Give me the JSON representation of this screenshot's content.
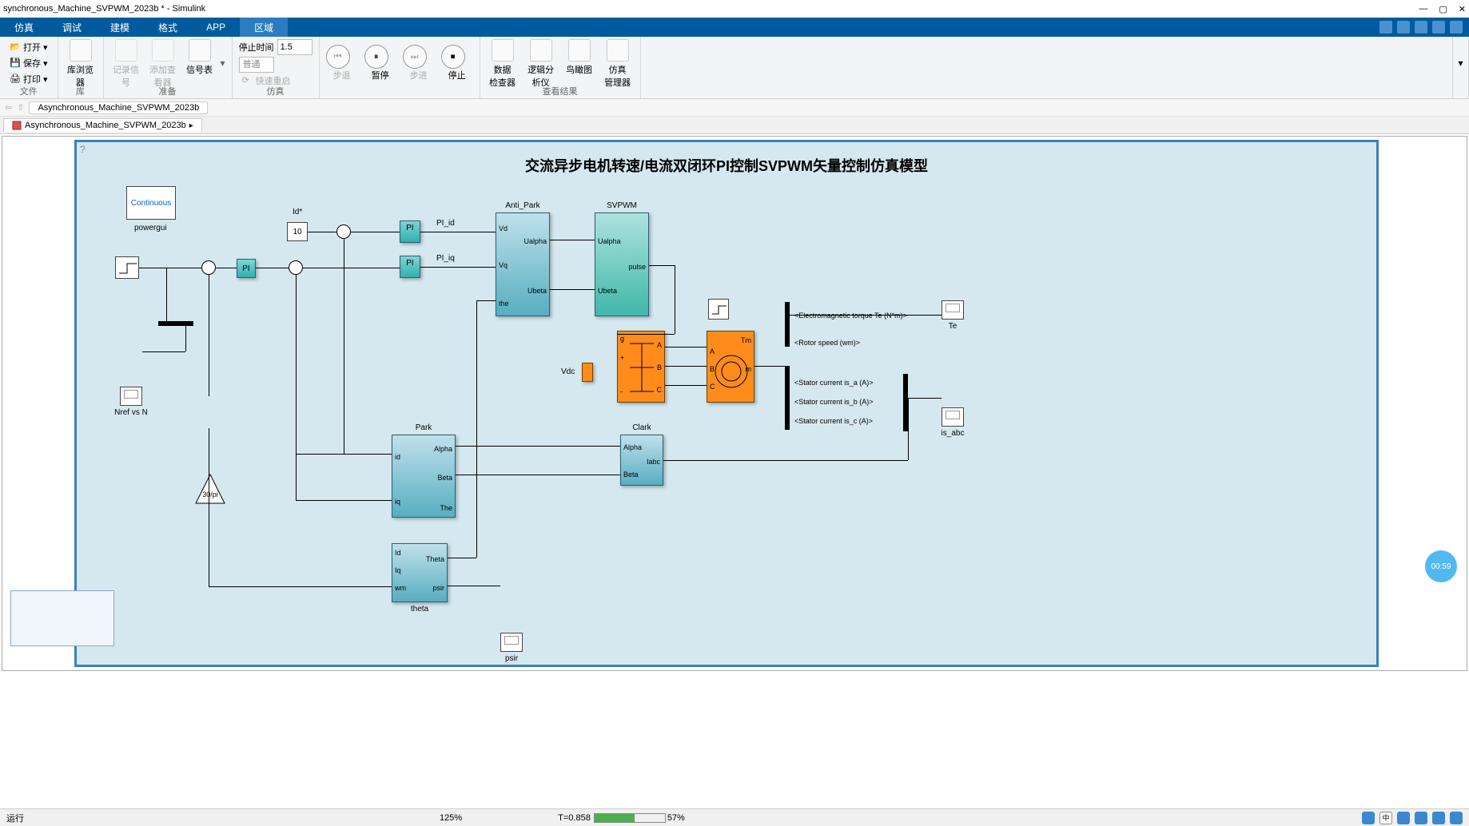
{
  "window": {
    "title": "synchronous_Machine_SVPWM_2023b * - Simulink"
  },
  "tabs": {
    "t1": "仿真",
    "t2": "调试",
    "t3": "建模",
    "t4": "格式",
    "t5": "APP",
    "t6": "区域"
  },
  "ribbon": {
    "file": {
      "open": "打开",
      "save": "保存",
      "print": "打印",
      "label": "文件"
    },
    "lib": {
      "browser": "库浏览器",
      "label": "库"
    },
    "prep": {
      "rec": "记录信号",
      "addv": "添加查看器",
      "sigtbl": "信号表",
      "label": "准备"
    },
    "sim": {
      "stoptime_lbl": "停止时间",
      "stoptime": "1.5",
      "mode": "普通",
      "fastrestart": "快速重启",
      "stepback": "步退",
      "pause": "暂停",
      "stepfwd": "步进",
      "stop": "停止",
      "label": "仿真"
    },
    "review": {
      "datainsp": "数据\n检查器",
      "logic": "逻辑分析仪",
      "bird": "鸟瞰图",
      "simmgr": "仿真\n管理器",
      "label": "查看结果"
    }
  },
  "nav": {
    "path": "Asynchronous_Machine_SVPWM_2023b"
  },
  "doctab": {
    "name": "Asynchronous_Machine_SVPWM_2023b"
  },
  "model": {
    "title": "交流异步电机转速/电流双闭环PI控制SVPWM矢量控制仿真模型",
    "powergui": "Continuous",
    "powergui_lbl": "powergui",
    "const_id": "10",
    "id_star": "Id*",
    "pi": "PI",
    "pi_id": "PI_id",
    "pi_iq": "PI_iq",
    "anti_park": "Anti_Park",
    "ap_vd": "Vd",
    "ap_vq": "Vq",
    "ap_the": "the",
    "ap_ua": "Ualpha",
    "ap_ub": "Ubeta",
    "svpwm": "SVPWM",
    "sv_ua": "Ualpha",
    "sv_ub": "Ubeta",
    "sv_pulse": "pulse",
    "vdc": "Vdc",
    "inv_g": "g",
    "inv_a": "A",
    "inv_b": "B",
    "inv_c": "C",
    "inv_p": "+",
    "inv_n": "-",
    "mot_tm": "Tm",
    "mot_a": "A",
    "mot_b": "B",
    "mot_c": "C",
    "mot_m": "m",
    "te": "<Electromagnetic torque Te (N*m)>",
    "te_lbl": "Te",
    "wm": "<Rotor speed (wm)>",
    "isa": "<Stator current is_a (A)>",
    "isb": "<Stator current is_b (A)>",
    "isc": "<Stator current is_c (A)>",
    "is_lbl": "is_abc",
    "nref": "Nref vs N",
    "gain": "30/pi",
    "park": "Park",
    "pk_id": "id",
    "pk_iq": "iq",
    "pk_alpha": "Alpha",
    "pk_beta": "Beta",
    "pk_the": "The",
    "clark": "Clark",
    "ck_alpha": "Alpha",
    "ck_beta": "Beta",
    "ck_iabc": "Iabc",
    "theta": "theta",
    "th_id": "Id",
    "th_iq": "Iq",
    "th_wm": "wm",
    "th_theta": "Theta",
    "th_psir": "psir",
    "psir": "psir"
  },
  "status": {
    "running": "运行",
    "zoom": "125%",
    "time": "T=0.858",
    "pct": "57%"
  },
  "timer": "00:59"
}
